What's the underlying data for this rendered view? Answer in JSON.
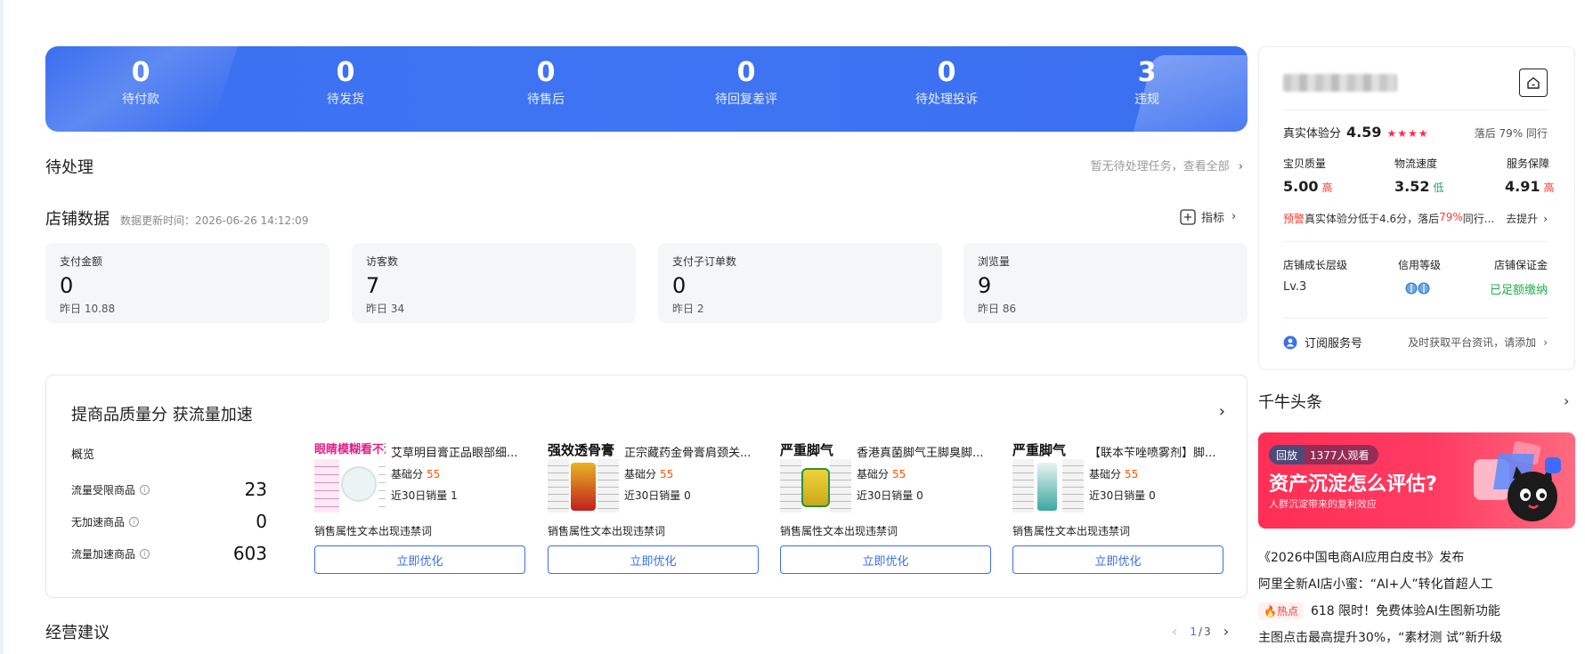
{
  "status_bar": {
    "items": [
      {
        "value": "0",
        "label": "待付款"
      },
      {
        "value": "0",
        "label": "待发货"
      },
      {
        "value": "0",
        "label": "待售后"
      },
      {
        "value": "0",
        "label": "待回复差评"
      },
      {
        "value": "0",
        "label": "待处理投诉"
      },
      {
        "value": "3",
        "label": "违规"
      }
    ]
  },
  "pending": {
    "title": "待处理",
    "empty_text": "暂无待处理任务，查看全部"
  },
  "shop_data": {
    "title": "店铺数据",
    "updated": "数据更新时间：2026-06-26 14:12:09",
    "indicator_label": "指标",
    "cards": [
      {
        "title": "支付金额",
        "value": "0",
        "yesterday": "昨日 10.88"
      },
      {
        "title": "访客数",
        "value": "7",
        "yesterday": "昨日 34"
      },
      {
        "title": "支付子订单数",
        "value": "0",
        "yesterday": "昨日 2"
      },
      {
        "title": "浏览量",
        "value": "9",
        "yesterday": "昨日 86"
      }
    ]
  },
  "quality": {
    "title": "提商品质量分 获流量加速",
    "overview_label": "概览",
    "overview": [
      {
        "label": "流量受限商品",
        "value": "23"
      },
      {
        "label": "无加速商品",
        "value": "0"
      },
      {
        "label": "流量加速商品",
        "value": "603"
      }
    ],
    "products": [
      {
        "name": "艾草明目膏正品眼部细...",
        "thumb_text": "眼睛模糊看不清",
        "thumb_color": "#e0218a",
        "score_label": "基础分",
        "score": "55",
        "sales": "近30日销量 1",
        "warning": "销售属性文本出现违禁词",
        "button": "立即优化"
      },
      {
        "name": "正宗藏药金骨膏肩颈关...",
        "thumb_text": "强效透骨膏",
        "thumb_color": "#111111",
        "score_label": "基础分",
        "score": "55",
        "sales": "近30日销量 0",
        "warning": "销售属性文本出现违禁词",
        "button": "立即优化"
      },
      {
        "name": "香港真菌脚气王脚臭脚...",
        "thumb_text": "严重脚气",
        "thumb_color": "#111111",
        "score_label": "基础分",
        "score": "55",
        "sales": "近30日销量 0",
        "warning": "销售属性文本出现违禁词",
        "button": "立即优化"
      },
      {
        "name": "【联本苄唑喷雾剂】脚...",
        "thumb_text": "严重脚气",
        "thumb_color": "#111111",
        "score_label": "基础分",
        "score": "55",
        "sales": "近30日销量 0",
        "warning": "销售属性文本出现违禁词",
        "button": "立即优化"
      }
    ]
  },
  "advice": {
    "title": "经营建议",
    "page_current": "1",
    "page_total": "3"
  },
  "shop_card": {
    "exp_label": "真实体验分",
    "exp_score": "4.59",
    "stars": "★★★★",
    "exp_rank": "落后 79% 同行",
    "metrics": [
      {
        "label": "宝贝质量",
        "value": "5.00",
        "tag": "高",
        "tag_color": "#ff3b30"
      },
      {
        "label": "物流速度",
        "value": "3.52",
        "tag": "低",
        "tag_color": "#1aa36b"
      },
      {
        "label": "服务保障",
        "value": "4.91",
        "tag": "高",
        "tag_color": "#ff3b30"
      }
    ],
    "warn_tag": "预警",
    "warn_text_1": "真实体验分低于4.6分，落后",
    "warn_pct": "79%",
    "warn_text_2": "同行...",
    "warn_action": "去提升",
    "levels": [
      {
        "label": "店铺成长层级",
        "value": "Lv.3"
      },
      {
        "label": "信用等级",
        "value": ""
      },
      {
        "label": "店铺保证金",
        "value": "已足额缴纳"
      }
    ],
    "subscribe_label": "订阅服务号",
    "subscribe_hint": "及时获取平台资讯，请添加"
  },
  "news": {
    "title": "千牛头条",
    "banner": {
      "tag": "回放",
      "viewers": "1377人观看",
      "headline": "资产沉淀怎么评估?",
      "subline": "人群沉淀带来的复利效应"
    },
    "items": [
      {
        "text": "《2026中国电商AI应用白皮书》发布"
      },
      {
        "text": "阿里全新AI店小蜜：“AI+人”转化首超人工"
      },
      {
        "hot": "热点",
        "text": "618 限时！免费体验AI生图新功能"
      },
      {
        "text": "主图点击最高提升30%，“素材测 试”新升级"
      }
    ]
  }
}
